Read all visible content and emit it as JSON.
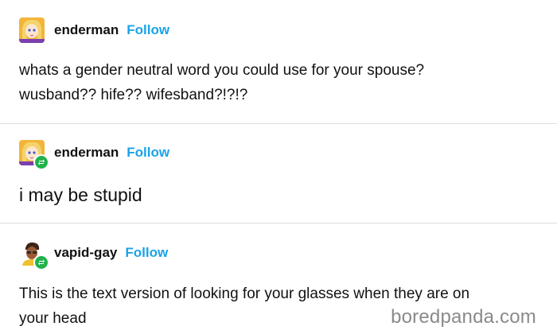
{
  "posts": [
    {
      "username": "enderman",
      "follow_label": "Follow",
      "avatar_icon": "anime-avatar-icon",
      "reblogged": false,
      "text_lines": [
        "whats a gender neutral word you could use for your spouse?",
        "wusband?? hife?? wifesband?!?!?"
      ]
    },
    {
      "username": "enderman",
      "follow_label": "Follow",
      "avatar_icon": "anime-avatar-icon",
      "reblogged": true,
      "text": "i may be stupid"
    },
    {
      "username": "vapid-gay",
      "follow_label": "Follow",
      "avatar_icon": "cartoon-avatar-icon",
      "reblogged": true,
      "text_lines": [
        "This is the text version of looking for your glasses when they are on",
        "your head"
      ]
    }
  ],
  "watermark": "boredpanda.com",
  "colors": {
    "follow": "#1aa3e8",
    "reblog_badge": "#23b14d",
    "divider": "#dcdcdc",
    "text": "#111111",
    "watermark": "#8a8a8a"
  }
}
